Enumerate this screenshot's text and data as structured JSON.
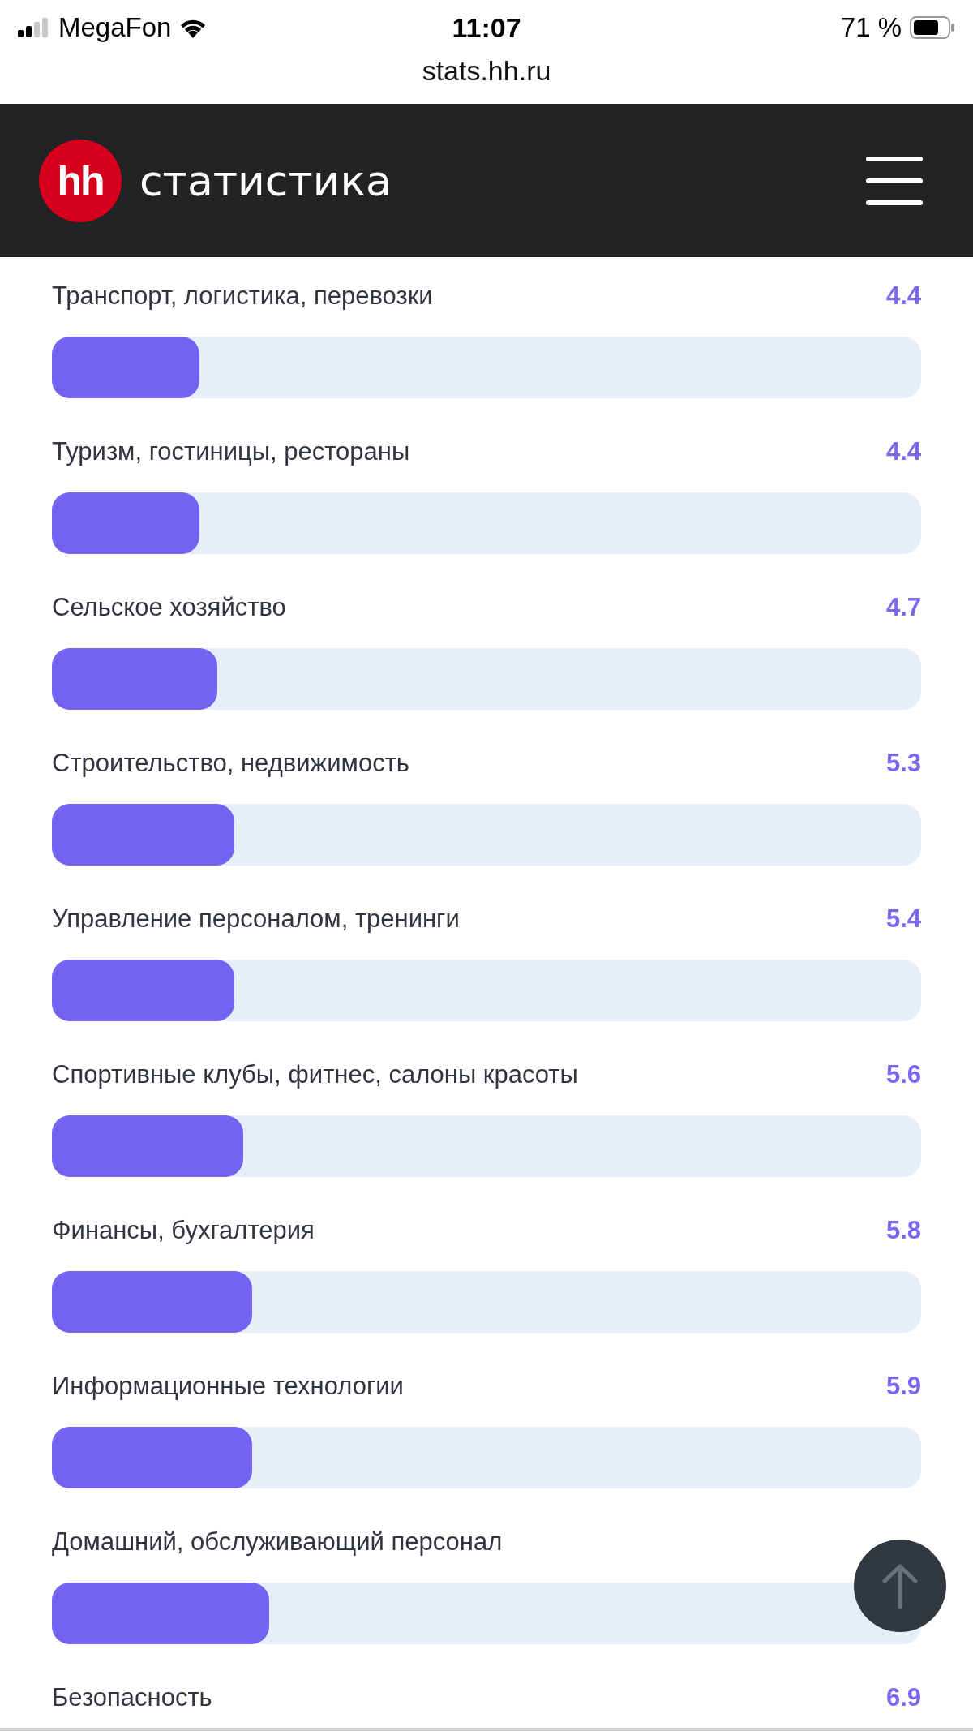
{
  "status_bar": {
    "carrier": "MegaFon",
    "time": "11:07",
    "battery": "71 %",
    "url": "stats.hh.ru"
  },
  "header": {
    "logo": "hh",
    "title": "статистика"
  },
  "rows": [
    {
      "label": "Транспорт, логистика, перевозки",
      "value": "4.4",
      "level": 0.17
    },
    {
      "label": "Туризм, гостиницы, рестораны",
      "value": "4.4",
      "level": 0.17
    },
    {
      "label": "Сельское хозяйство",
      "value": "4.7",
      "level": 0.19
    },
    {
      "label": "Строительство, недвижимость",
      "value": "5.3",
      "level": 0.21
    },
    {
      "label": "Управление персоналом, тренинги",
      "value": "5.4",
      "level": 0.21
    },
    {
      "label": "Спортивные клубы, фитнес, салоны красоты",
      "value": "5.6",
      "level": 0.22
    },
    {
      "label": "Финансы, бухгалтерия",
      "value": "5.8",
      "level": 0.23
    },
    {
      "label": "Информационные технологии",
      "value": "5.9",
      "level": 0.23
    },
    {
      "label": "Домашний, обслуживающий персонал",
      "level": 0.25
    },
    {
      "label": "Безопасность",
      "value": "6.9"
    }
  ]
}
